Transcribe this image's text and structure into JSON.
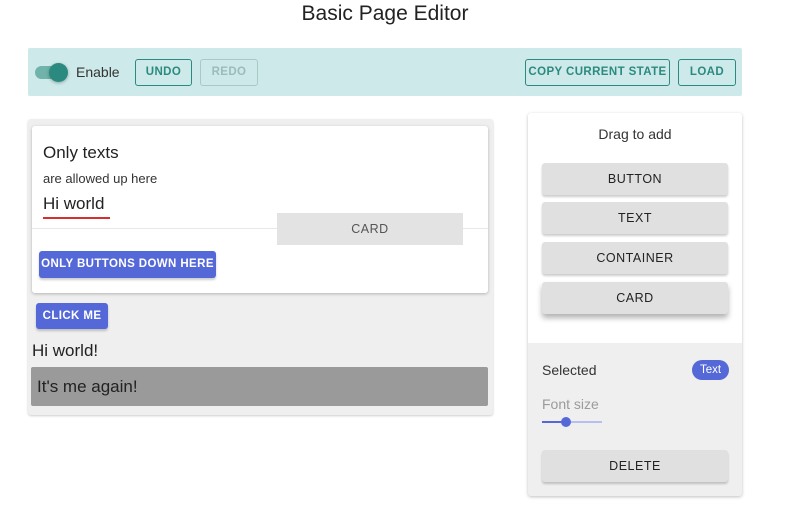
{
  "header": {
    "title": "Basic Page Editor"
  },
  "toolbar": {
    "enable_label": "Enable",
    "enabled": true,
    "undo_label": "UNDO",
    "redo_label": "REDO",
    "copy_label": "COPY CURRENT STATE",
    "load_label": "LOAD"
  },
  "editor": {
    "card": {
      "text_large": "Only texts",
      "text_small": "are allowed up here",
      "text_selected": "Hi world",
      "ghost_label": "CARD",
      "button_label": "ONLY BUTTONS DOWN HERE"
    },
    "click_button_label": "CLICK ME",
    "hi_text": "Hi world!",
    "gray_text": "It's me again!"
  },
  "panel": {
    "drag_title": "Drag to add",
    "items": [
      "BUTTON",
      "TEXT",
      "CONTAINER",
      "CARD"
    ],
    "selected_label": "Selected",
    "selected_chip": "Text",
    "font_size_label": "Font size",
    "font_size_value": 0.4,
    "delete_label": "DELETE"
  },
  "colors": {
    "toolbar_bg": "#cde9e9",
    "teal": "#2b8a7f",
    "primary": "#5568d8",
    "selection_underline": "#d32f2f"
  }
}
